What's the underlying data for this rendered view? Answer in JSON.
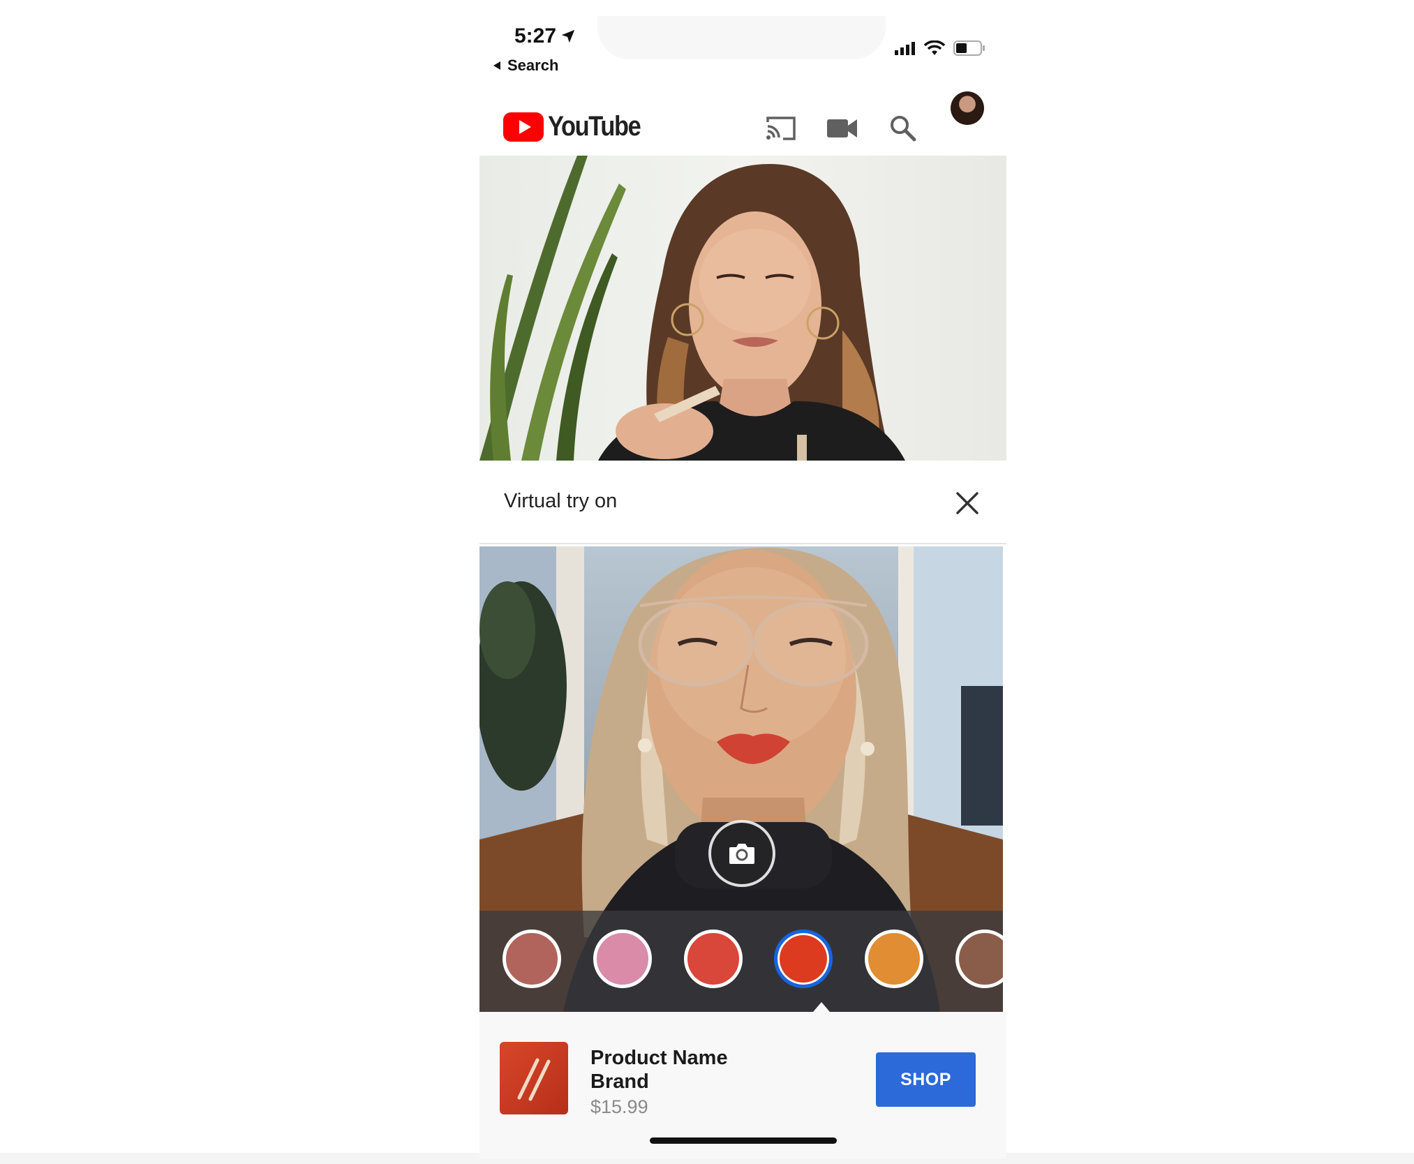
{
  "status_bar": {
    "time": "5:27",
    "back_label": "Search",
    "icons": [
      "location-arrow-icon",
      "signal-icon",
      "wifi-icon",
      "battery-icon"
    ]
  },
  "header": {
    "logo_text": "YouTube",
    "brand_color": "#ff0000",
    "actions": [
      "cast-icon",
      "camera-icon",
      "search-icon",
      "avatar"
    ]
  },
  "tryon": {
    "title": "Virtual try on"
  },
  "swatches": [
    {
      "color": "#b0645c",
      "selected": false
    },
    {
      "color": "#d98ba8",
      "selected": false
    },
    {
      "color": "#d9473a",
      "selected": false
    },
    {
      "color": "#dc3b1f",
      "selected": true
    },
    {
      "color": "#e08d33",
      "selected": false
    },
    {
      "color": "#8a5d4a",
      "selected": false
    }
  ],
  "product": {
    "name": "Product Name",
    "brand": "Brand",
    "price": "$15.99",
    "shop_label": "SHOP",
    "shop_color": "#2d6ad9"
  }
}
